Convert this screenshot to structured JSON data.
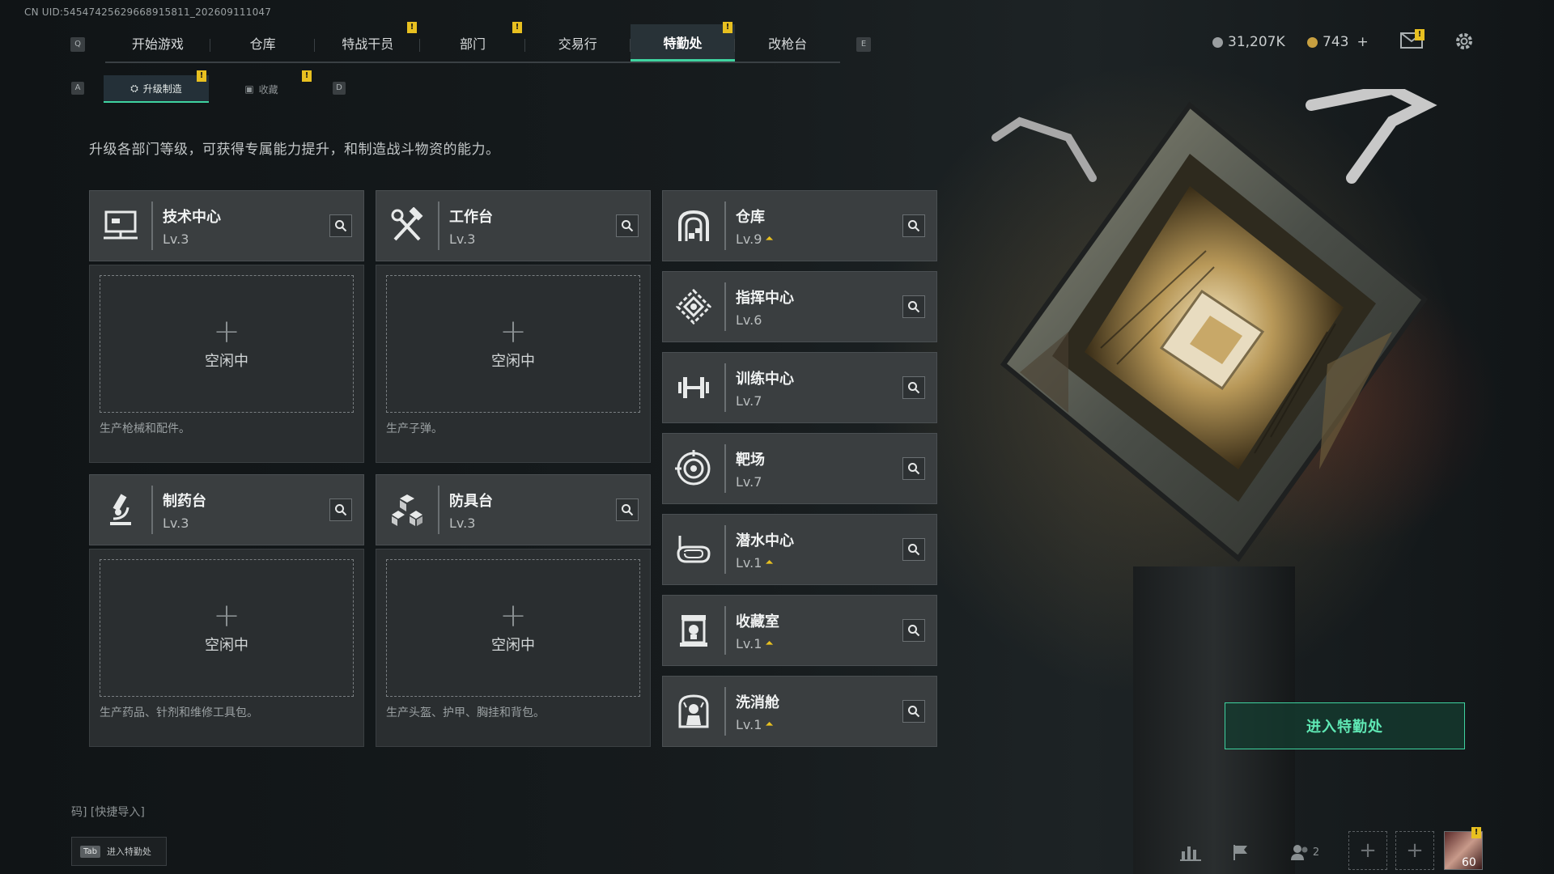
{
  "uid_text": "CN UID:54547425629668915811_202609111047",
  "nav": {
    "left_key": "Q",
    "right_key": "E",
    "tabs": [
      {
        "label": "开始游戏"
      },
      {
        "label": "仓库"
      },
      {
        "label": "特战干员"
      },
      {
        "label": "部门"
      },
      {
        "label": "交易行"
      },
      {
        "label": "特勤处"
      },
      {
        "label": "改枪台"
      }
    ],
    "active_tab": "特勤处"
  },
  "notif_mark": "!",
  "currency": {
    "coins": "31,207K",
    "tokens": "743",
    "add": "+"
  },
  "subnav": {
    "left_key": "A",
    "right_key": "D",
    "tabs": [
      {
        "label": "升级制造"
      },
      {
        "label": "收藏"
      }
    ]
  },
  "description": "升级各部门等级，可获得专属能力提升，和制造战斗物资的能力。",
  "workshops": [
    {
      "name": "技术中心",
      "level": "Lv.3",
      "icon": "computer-icon",
      "plus": "+",
      "status": "空闲中",
      "desc": "生产枪械和配件。"
    },
    {
      "name": "工作台",
      "level": "Lv.3",
      "icon": "tools-icon",
      "plus": "+",
      "status": "空闲中",
      "desc": "生产子弹。"
    },
    {
      "name": "制药台",
      "level": "Lv.3",
      "icon": "microscope-icon",
      "plus": "+",
      "status": "空闲中",
      "desc": "生产药品、针剂和维修工具包。"
    },
    {
      "name": "防具台",
      "level": "Lv.3",
      "icon": "cubes-icon",
      "plus": "+",
      "status": "空闲中",
      "desc": "生产头盔、护甲、胸挂和背包。"
    }
  ],
  "facilities": [
    {
      "name": "仓库",
      "level": "Lv.9",
      "upgradable": true,
      "icon": "warehouse-icon"
    },
    {
      "name": "指挥中心",
      "level": "Lv.6",
      "upgradable": false,
      "icon": "command-icon"
    },
    {
      "name": "训练中心",
      "level": "Lv.7",
      "upgradable": false,
      "icon": "dumbbell-icon"
    },
    {
      "name": "靶场",
      "level": "Lv.7",
      "upgradable": false,
      "icon": "target-icon"
    },
    {
      "name": "潜水中心",
      "level": "Lv.1",
      "upgradable": true,
      "icon": "diving-mask-icon"
    },
    {
      "name": "收藏室",
      "level": "Lv.1",
      "upgradable": true,
      "icon": "collection-icon"
    },
    {
      "name": "洗消舱",
      "level": "Lv.1",
      "upgradable": true,
      "icon": "decon-icon"
    }
  ],
  "enter_button": "进入特勤处",
  "bottom": {
    "code_link": "码]  [快捷导入]",
    "tab_key": "Tab",
    "tab_hint": "进入特勤处",
    "friends_count": "2",
    "player_level": "60"
  },
  "colors": {
    "accent": "#3fd3a0",
    "notif": "#e8c020",
    "card": "#3a3e40"
  }
}
